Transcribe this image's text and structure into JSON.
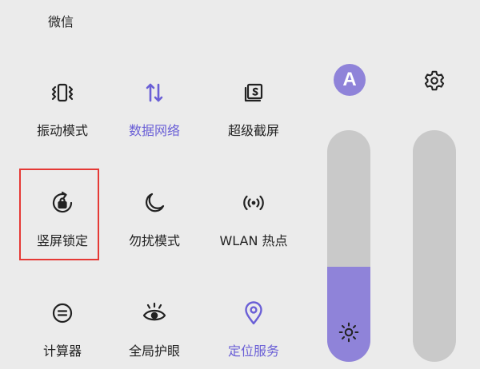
{
  "top_app_label": "微信",
  "tiles": [
    {
      "id": "vibrate",
      "label": "振动模式",
      "icon": "vibrate-icon",
      "active": false
    },
    {
      "id": "mobile-data",
      "label": "数据网络",
      "icon": "mobile-data-icon",
      "active": true
    },
    {
      "id": "screenshot",
      "label": "超级截屏",
      "icon": "screenshot-icon",
      "active": false
    },
    {
      "id": "rotation-lock",
      "label": "竖屏锁定",
      "icon": "rotation-lock-icon",
      "active": false
    },
    {
      "id": "do-not-disturb",
      "label": "勿扰模式",
      "icon": "moon-icon",
      "active": false
    },
    {
      "id": "hotspot",
      "label": "WLAN 热点",
      "icon": "hotspot-icon",
      "active": false
    },
    {
      "id": "calculator",
      "label": "计算器",
      "icon": "calculator-icon",
      "active": false
    },
    {
      "id": "eye-comfort",
      "label": "全局护眼",
      "icon": "eye-icon",
      "active": false
    },
    {
      "id": "location",
      "label": "定位服务",
      "icon": "location-pin-icon",
      "active": true
    }
  ],
  "auto_brightness_label": "A",
  "brightness_level": 0.41,
  "colors": {
    "accent": "#8f83d9",
    "active_text": "#6a5fd6",
    "highlight": "#e53935",
    "background": "#ebebeb",
    "track": "#c9c9c9"
  }
}
